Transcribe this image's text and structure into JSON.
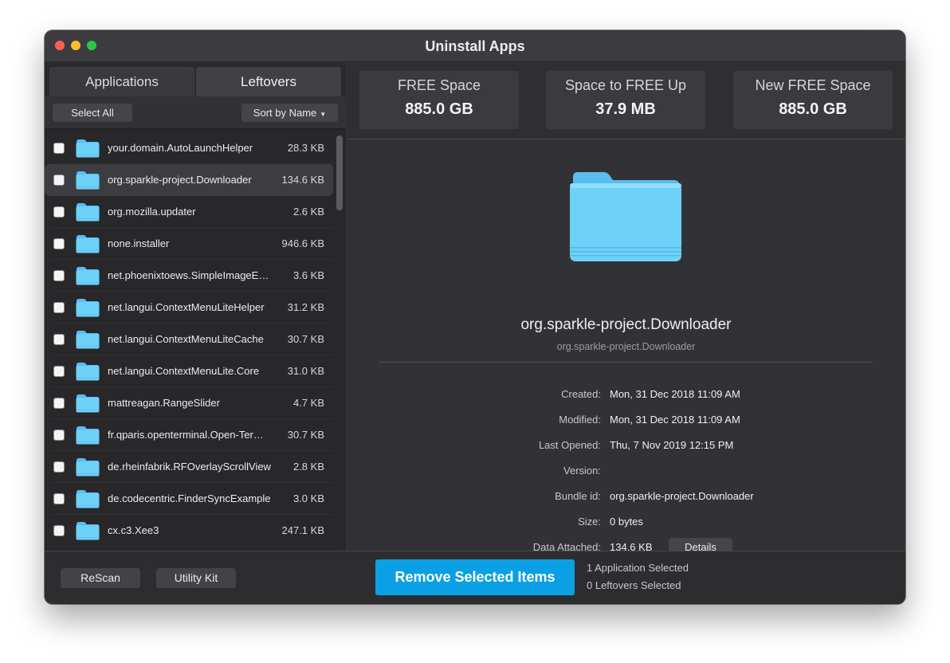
{
  "window": {
    "title": "Uninstall Apps"
  },
  "tabs": {
    "applications": "Applications",
    "leftovers": "Leftovers",
    "active": "Leftovers"
  },
  "list_toolbar": {
    "select_all": "Select All",
    "sort": "Sort by Name"
  },
  "leftovers": [
    {
      "name": "your.domain.AutoLaunchHelper",
      "size": "28.3 KB",
      "checked": false,
      "selected": false
    },
    {
      "name": "org.sparkle-project.Downloader",
      "size": "134.6 KB",
      "checked": false,
      "selected": true
    },
    {
      "name": "org.mozilla.updater",
      "size": "2.6 KB",
      "checked": false,
      "selected": false
    },
    {
      "name": "none.installer",
      "size": "946.6 KB",
      "checked": false,
      "selected": false
    },
    {
      "name": "net.phoenixtoews.SimpleImageEditor",
      "size": "3.6 KB",
      "checked": false,
      "selected": false
    },
    {
      "name": "net.langui.ContextMenuLiteHelper",
      "size": "31.2 KB",
      "checked": false,
      "selected": false
    },
    {
      "name": "net.langui.ContextMenuLiteCache",
      "size": "30.7 KB",
      "checked": false,
      "selected": false
    },
    {
      "name": "net.langui.ContextMenuLite.Core",
      "size": "31.0 KB",
      "checked": false,
      "selected": false
    },
    {
      "name": "mattreagan.RangeSlider",
      "size": "4.7 KB",
      "checked": false,
      "selected": false
    },
    {
      "name": "fr.qparis.openterminal.Open-Terminal",
      "size": "30.7 KB",
      "checked": false,
      "selected": false
    },
    {
      "name": "de.rheinfabrik.RFOverlayScrollView",
      "size": "2.8 KB",
      "checked": false,
      "selected": false
    },
    {
      "name": "de.codecentric.FinderSyncExample",
      "size": "3.0 KB",
      "checked": false,
      "selected": false
    },
    {
      "name": "cx.c3.Xee3",
      "size": "247.1 KB",
      "checked": false,
      "selected": false
    }
  ],
  "stats": [
    {
      "label": "FREE Space",
      "value": "885.0 GB"
    },
    {
      "label": "Space to FREE Up",
      "value": "37.9 MB"
    },
    {
      "label": "New FREE Space",
      "value": "885.0 GB"
    }
  ],
  "detail": {
    "name": "org.sparkle-project.Downloader",
    "subtitle": "org.sparkle-project.Downloader",
    "icon": "folder-icon",
    "fields": [
      {
        "label": "Created:",
        "value": "Mon, 31 Dec 2018 11:09 AM"
      },
      {
        "label": "Modified:",
        "value": "Mon, 31 Dec 2018 11:09 AM"
      },
      {
        "label": "Last Opened:",
        "value": "Thu, 7 Nov 2019 12:15 PM"
      },
      {
        "label": "Version:",
        "value": ""
      },
      {
        "label": "Bundle id:",
        "value": "org.sparkle-project.Downloader"
      },
      {
        "label": "Size:",
        "value": "0 bytes"
      },
      {
        "label": "Data Attached:",
        "value": "134.6 KB"
      }
    ],
    "details_button": "Details"
  },
  "footer": {
    "rescan": "ReScan",
    "utility_kit": "Utility Kit",
    "remove": "Remove Selected Items",
    "apps_selected": "1 Application Selected",
    "leftovers_selected": "0 Leftovers Selected"
  },
  "colors": {
    "accent": "#0ba0e5",
    "folder": "#5ccaf4",
    "background": "#323236"
  }
}
